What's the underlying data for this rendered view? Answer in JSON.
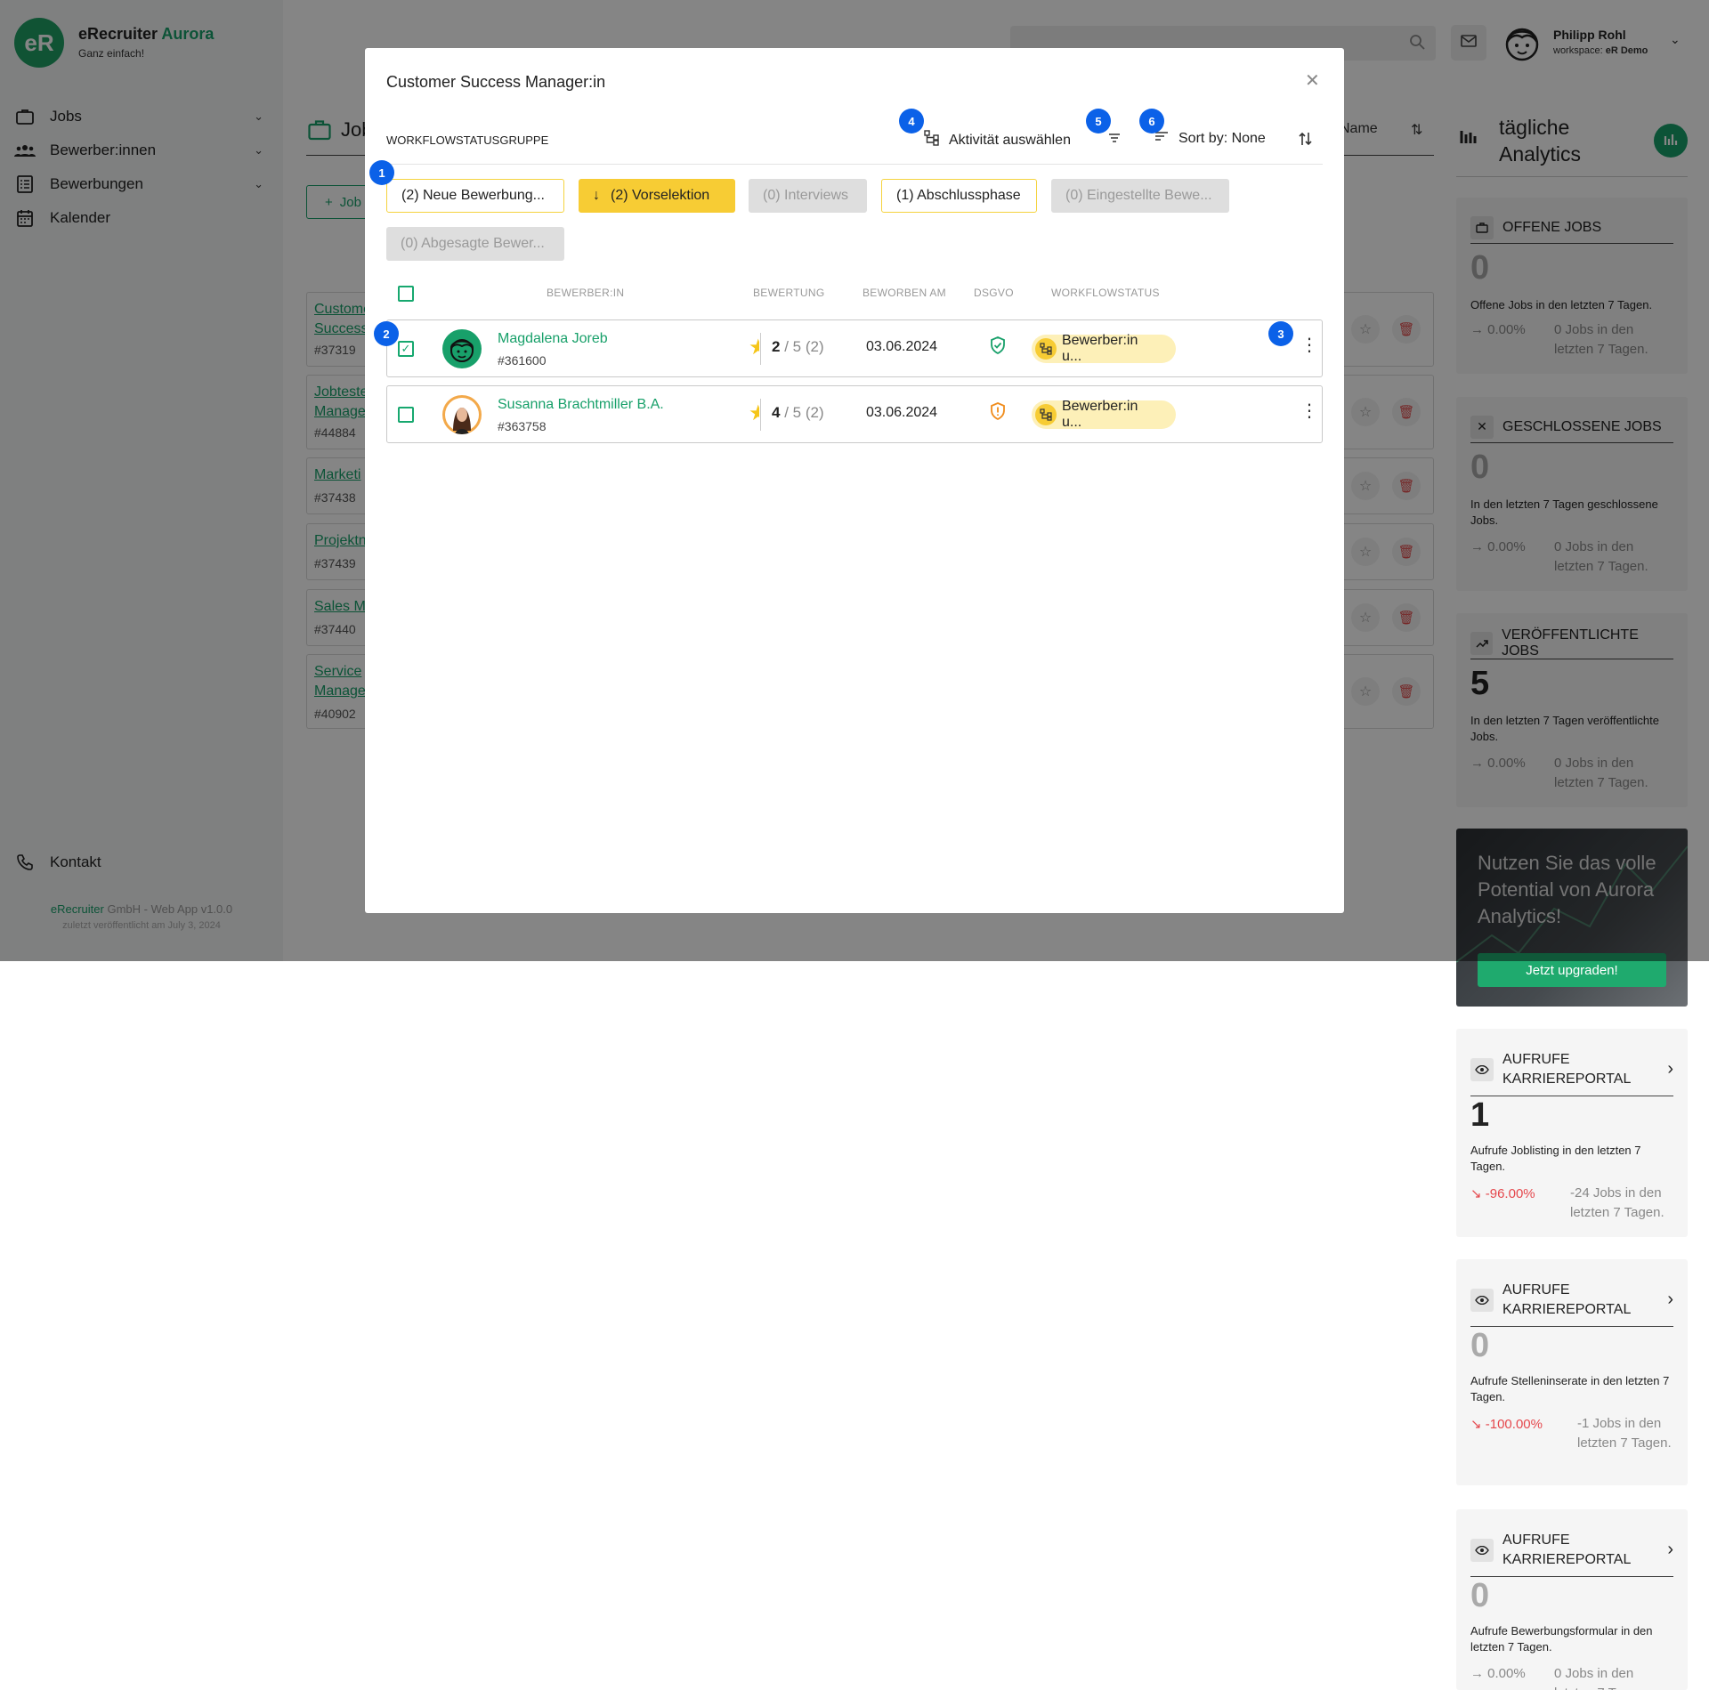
{
  "brand": {
    "logo": "eR",
    "name": "eRecruiter",
    "name_accent": "Aurora",
    "tagline": "Ganz einfach!"
  },
  "nav": {
    "items": [
      {
        "label": "Jobs",
        "icon": "briefcase-icon"
      },
      {
        "label": "Bewerber:innen",
        "icon": "people-icon"
      },
      {
        "label": "Bewerbungen",
        "icon": "list-icon"
      },
      {
        "label": "Kalender",
        "icon": "calendar-icon"
      }
    ],
    "contact": "Kontakt"
  },
  "footer": {
    "company_accent": "eRecruiter",
    "company": " GmbH - Web App v1.0.0",
    "published": "zuletzt veröffentlicht am July 3, 2024"
  },
  "user": {
    "name": "Philipp Rohl",
    "workspace_label": "workspace: ",
    "workspace": "eR Demo"
  },
  "main": {
    "title": "Job",
    "add_label": "Job",
    "sort_label": "Name",
    "jobs": [
      {
        "title": "Custome",
        "title2": "Success",
        "id": "#37319"
      },
      {
        "title": "Jobteste",
        "title2": "Manage",
        "id": "#44884"
      },
      {
        "title": "Marketi",
        "title2": "",
        "id": "#37438"
      },
      {
        "title": "Projektn",
        "title2": "",
        "id": "#37439"
      },
      {
        "title": "Sales M",
        "title2": "",
        "id": "#37440"
      },
      {
        "title": "Service",
        "title2": "Manage",
        "id": "#40902"
      }
    ]
  },
  "analytics": {
    "title_line1": "tägliche",
    "title_line2": "Analytics",
    "cards": [
      {
        "title": "OFFENE JOBS",
        "value": "0",
        "desc": "Offene Jobs in den letzten 7 Tagen.",
        "trend": "0.00%",
        "compare": "0 Jobs in den letzten 7 Tagen."
      },
      {
        "title": "GESCHLOSSENE JOBS",
        "value": "0",
        "desc": "In den letzten 7 Tagen geschlossene Jobs.",
        "trend": "0.00%",
        "compare": "0 Jobs in den letzten 7 Tagen."
      },
      {
        "title": "VERÖFFENTLICHTE JOBS",
        "value": "5",
        "desc": "In den letzten 7 Tagen veröffentlichte Jobs.",
        "trend": "0.00%",
        "compare": "0 Jobs in den letzten 7 Tagen."
      },
      {
        "title": "AUFRUFE KARRIEREPORTAL",
        "value": "1",
        "desc": "Aufrufe Joblisting in den letzten 7 Tagen.",
        "trend": "-96.00%",
        "compare": "-24 Jobs in den letzten 7 Tagen."
      },
      {
        "title": "AUFRUFE KARRIEREPORTAL",
        "value": "0",
        "desc": "Aufrufe Stelleninserate in den letzten 7 Tagen.",
        "trend": "-100.00%",
        "compare": "-1 Jobs in den letzten 7 Tagen."
      },
      {
        "title": "AUFRUFE KARRIEREPORTAL",
        "value": "0",
        "desc": "Aufrufe Bewerbungsformular in den letzten 7 Tagen.",
        "trend": "0.00%",
        "compare": "0 Jobs in den letzten 7 Tagen."
      }
    ],
    "promo": {
      "text": "Nutzen Sie das volle Potential von Aurora Analytics!",
      "button": "Jetzt upgraden!"
    },
    "colors": {
      "negative": "#e5484d",
      "neutral": "#999999"
    }
  },
  "modal": {
    "title": "Customer Success Manager:in",
    "group_label": "WORKFLOWSTATUSGRUPPE",
    "activity_label": "Aktivität auswählen",
    "sort_label": "Sort by: None",
    "chips": [
      {
        "label": "(2) Neue Bewerbung...",
        "state": "outline"
      },
      {
        "label": "(2) Vorselektion",
        "state": "active"
      },
      {
        "label": "(0) Interviews",
        "state": "disabled"
      },
      {
        "label": "(1) Abschlussphase",
        "state": "outline"
      },
      {
        "label": "(0) Eingestellte Bewe...",
        "state": "disabled"
      },
      {
        "label": "(0) Abgesagte Bewer...",
        "state": "disabled"
      }
    ],
    "columns": {
      "applicant": "BEWERBER:IN",
      "rating": "BEWERTUNG",
      "applied": "BEWORBEN AM",
      "gdpr": "DSGVO",
      "status": "WORKFLOWSTATUS"
    },
    "rows": [
      {
        "name": "Magdalena Joreb",
        "id": "#361600",
        "rating": "2",
        "rating_max": "/ 5",
        "rating_count": "(2)",
        "date": "03.06.2024",
        "status": "Bewerber:in u...",
        "checked": true,
        "gdpr": "ok"
      },
      {
        "name": "Susanna Brachtmiller B.A.",
        "id": "#363758",
        "rating": "4",
        "rating_max": "/ 5",
        "rating_count": "(2)",
        "date": "03.06.2024",
        "status": "Bewerber:in u...",
        "checked": false,
        "gdpr": "warning"
      }
    ],
    "badges": [
      "1",
      "2",
      "3",
      "4",
      "5",
      "6"
    ],
    "colors": {
      "accent": "#18a06a",
      "active_chip": "#f7cc34",
      "badge": "#0b61e8",
      "warning": "#f08c1c"
    }
  }
}
